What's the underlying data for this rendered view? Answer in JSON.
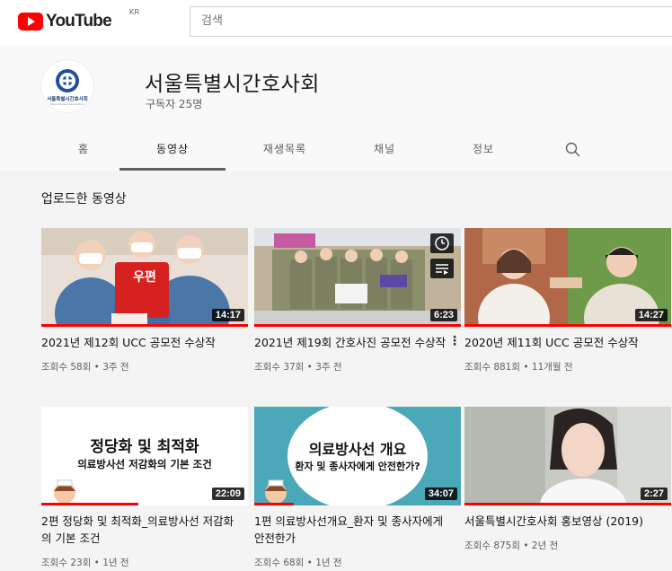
{
  "header": {
    "logo_text": "YouTube",
    "country_code": "KR",
    "search_placeholder": "검색"
  },
  "channel": {
    "name": "서울특별시간호사회",
    "subscribers": "구독자 25명",
    "avatar_text": "서울특별시간호사회",
    "avatar_subtext": "Seoul Nurses Association",
    "tabs": [
      "홈",
      "동영상",
      "재생목록",
      "채널",
      "정보"
    ],
    "active_tab": "동영상"
  },
  "section_title": "업로드한 동영상",
  "videos": [
    {
      "title": "2021년 제12회 UCC 공모전 수상작",
      "meta": "조회수 58회 • 3주 전",
      "duration": "14:17",
      "thumb_label": "우편",
      "watched": 1.0
    },
    {
      "title": "2021년 제19회 간호사진 공모전 수상작",
      "meta": "조회수 37회 • 3주 전",
      "duration": "6:23",
      "thumb_label": "",
      "watched": 1.0
    },
    {
      "title": "2020년 제11회 UCC 공모전 수상작",
      "meta": "조회수 881회 • 11개월 전",
      "duration": "14:27",
      "thumb_label": "",
      "watched": 1.0
    },
    {
      "title": "2편 정당화 및 최적화_의료방사선 저감화의 기본 조건",
      "meta": "조회수 23회 • 1년 전",
      "duration": "22:09",
      "thumb_line1": "정당화 및 최적화",
      "thumb_line2": "의료방사선 저감화의 기본 조건",
      "watched": 0.47
    },
    {
      "title": "1편 의료방사선개요_환자 및 종사자에게 안전한가",
      "meta": "조회수 68회 • 1년 전",
      "duration": "34:07",
      "thumb_line1": "의료방사선 개요",
      "thumb_line2": "환자 및 종사자에게 안전한가?",
      "watched": 0.19
    },
    {
      "title": "서울특별시간호사회 홍보영상 (2019)",
      "meta": "조회수 875회 • 2년 전",
      "duration": "2:27",
      "watched": 1.0
    }
  ],
  "colors": {
    "brand_red": "#ff0000",
    "content_bg": "#f4f4f4",
    "header_bg": "#f9f9f9",
    "thumb_teal": "#4aa8b8"
  },
  "icons": {
    "search": "search-icon",
    "more": "more-vert-icon",
    "watch_later": "clock-icon",
    "add_queue": "playlist-add-icon"
  }
}
